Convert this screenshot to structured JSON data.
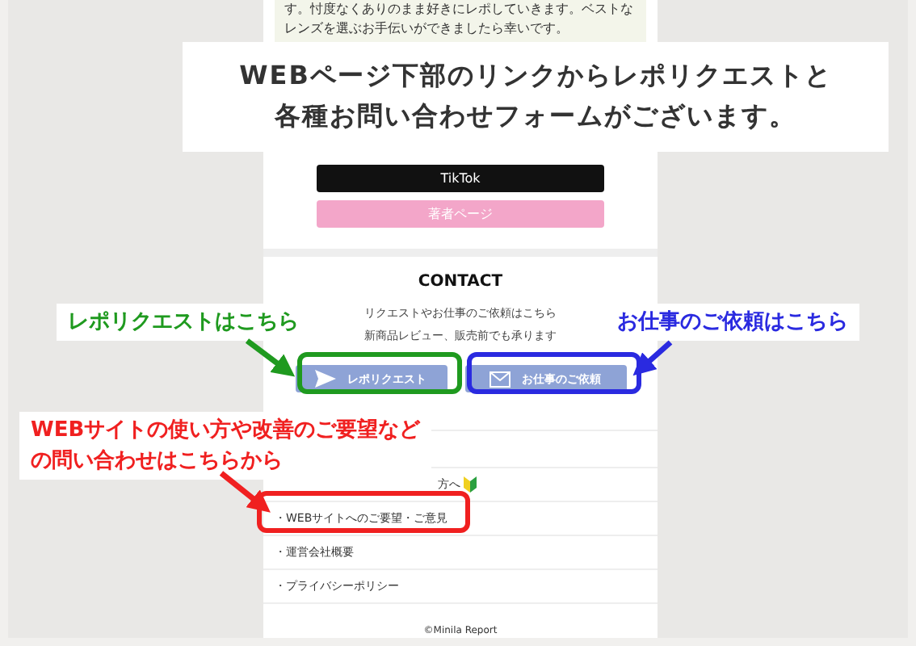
{
  "intro": {
    "lines": [
      "す。忖度なくありのまま好きにレポしていきます。ベストな",
      "レンズを選ぶお手伝いができましたら幸いです。"
    ]
  },
  "banner": {
    "lines": [
      "WEBページ下部のリンクからレポリクエストと",
      "各種お問い合わせフォームがございます。"
    ]
  },
  "link_buttons": [
    {
      "label": "TikTok",
      "kind": "dark"
    },
    {
      "label": "著者ページ",
      "kind": "pink"
    }
  ],
  "contact": {
    "title": "CONTACT",
    "lines": [
      "リクエストやお仕事のご依頼はこちら",
      "新商品レビュー、販売前でも承ります"
    ],
    "buttons": [
      {
        "label": "レポリクエスト",
        "kind": "send"
      },
      {
        "label": "お仕事のご依頼",
        "kind": "mail"
      }
    ]
  },
  "footer_links": [
    {
      "label": "方へ",
      "kind": "beginner"
    },
    {
      "label": "・WEBサイトへのご要望・ご意見",
      "kind": "plain"
    },
    {
      "label": "・運営会社概要",
      "kind": "plain"
    },
    {
      "label": "・プライバシーポリシー",
      "kind": "plain"
    }
  ],
  "copyright": "©Minila Report",
  "callouts": [
    {
      "lines": [
        "レポリクエストはこちら"
      ],
      "color": "#1f9a1f"
    },
    {
      "lines": [
        "お仕事のご依頼はこちら"
      ],
      "color": "#2a2ae0"
    },
    {
      "lines": [
        "WEBサイトの使い方や改善のご要望など",
        "の問い合わせはこちらから"
      ],
      "color": "#f02020"
    }
  ]
}
